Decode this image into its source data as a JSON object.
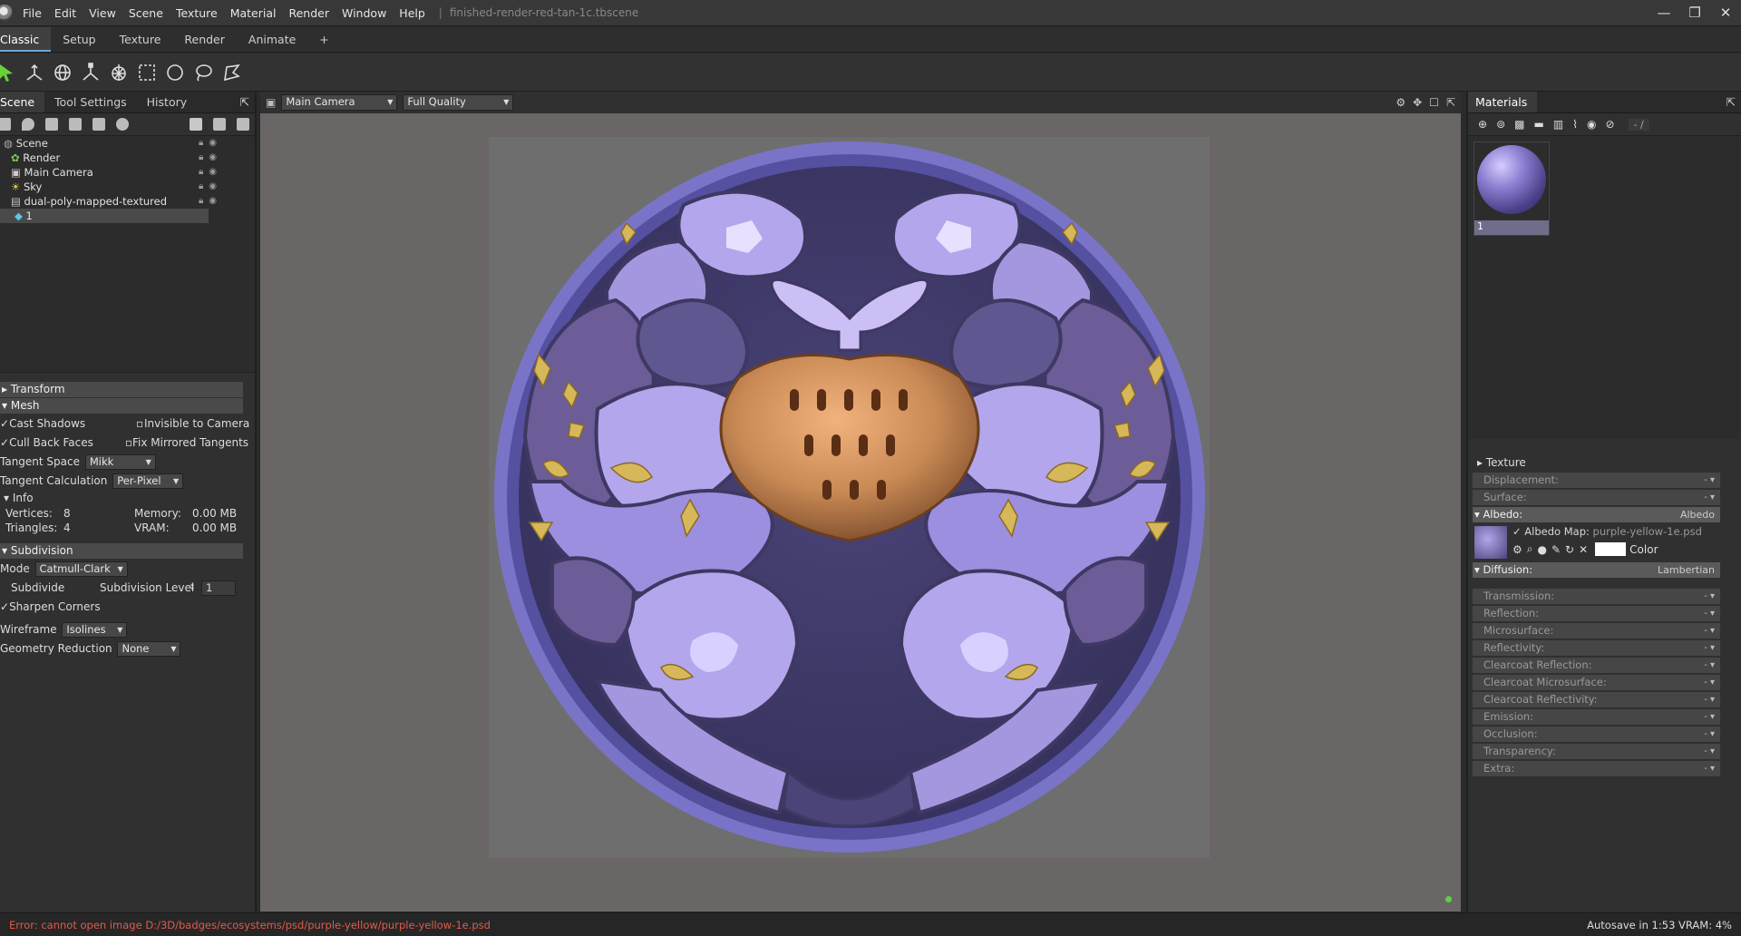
{
  "app": {
    "menu": [
      "File",
      "Edit",
      "View",
      "Scene",
      "Texture",
      "Material",
      "Render",
      "Window",
      "Help"
    ],
    "filename": "finished-render-red-tan-1c.tbscene",
    "win_controls": [
      "—",
      "❐",
      "✕"
    ]
  },
  "tabs": [
    "Classic",
    "Setup",
    "Texture",
    "Render",
    "Animate",
    "+"
  ],
  "left_panel": {
    "tabs": [
      "Scene",
      "Tool Settings",
      "History"
    ],
    "tree": [
      {
        "label": "Scene",
        "indent": 0
      },
      {
        "label": "Render",
        "indent": 1
      },
      {
        "label": "Main Camera",
        "indent": 1
      },
      {
        "label": "Sky",
        "indent": 1
      },
      {
        "label": "dual-poly-mapped-textured",
        "indent": 1
      },
      {
        "label": "1",
        "indent": 2
      }
    ],
    "transform_label": "Transform",
    "mesh": {
      "header": "Mesh",
      "cast_shadows": "Cast Shadows",
      "invisible_to_camera": "Invisible to Camera",
      "cull_back_faces": "Cull Back Faces",
      "fix_mirrored_tangents": "Fix Mirrored Tangents",
      "tangent_space_label": "Tangent Space",
      "tangent_space_value": "Mikk",
      "tangent_calc_label": "Tangent Calculation",
      "tangent_calc_value": "Per-Pixel",
      "info_header": "Info",
      "vertices_label": "Vertices:",
      "vertices_value": "8",
      "triangles_label": "Triangles:",
      "triangles_value": "4",
      "memory_label": "Memory:",
      "memory_value": "0.00 MB",
      "vram_label": "VRAM:",
      "vram_value": "0.00 MB"
    },
    "subdivision": {
      "header": "Subdivision",
      "mode_label": "Mode",
      "mode_value": "Catmull-Clark",
      "subdivide": "Subdivide",
      "level_label": "Subdivision Level",
      "level_value": "1",
      "sharpen_corners": "Sharpen Corners",
      "wireframe_label": "Wireframe",
      "wireframe_value": "Isolines",
      "geo_reduction_label": "Geometry Reduction",
      "geo_reduction_value": "None"
    }
  },
  "viewport": {
    "camera": "Main Camera",
    "quality": "Full Quality"
  },
  "right_panel": {
    "title": "Materials",
    "mat_counter": "- /",
    "material_name": "1",
    "texture_header": "Texture",
    "props_top": [
      "Displacement:",
      "Surface:"
    ],
    "albedo_label": "Albedo:",
    "albedo_value": "Albedo",
    "albedo_map_label": "Albedo Map:",
    "albedo_map_value": "purple-yellow-1e.psd",
    "color_label": "Color",
    "diffusion_label": "Diffusion:",
    "diffusion_value": "Lambertian",
    "props_bottom": [
      "Transmission:",
      "Reflection:",
      "Microsurface:",
      "Reflectivity:",
      "Clearcoat Reflection:",
      "Clearcoat Microsurface:",
      "Clearcoat Reflectivity:",
      "Emission:",
      "Occlusion:",
      "Transparency:",
      "Extra:"
    ],
    "dash": "- ▾"
  },
  "status": {
    "error": "Error: cannot open image D:/3D/badges/ecosystems/psd/purple-yellow/purple-yellow-1e.psd",
    "right": "Autosave in 1:53  VRAM: 4%"
  },
  "colors": {
    "accent": "#6fa8d6",
    "error": "#e05a4a",
    "badge_rim": "#7a74c8",
    "badge_purple_light": "#b3a6ec",
    "badge_purple_dark": "#3e3862",
    "badge_gold": "#d6b75a",
    "badge_tan": "#c98a55"
  }
}
